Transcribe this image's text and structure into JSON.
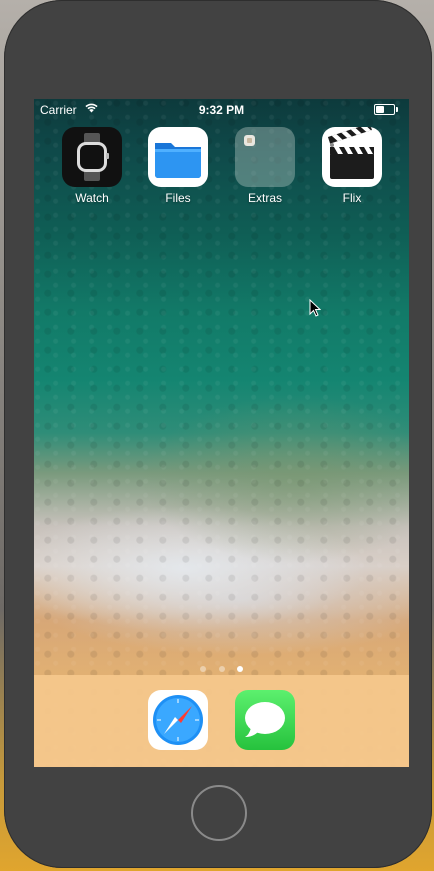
{
  "status_bar": {
    "carrier": "Carrier",
    "time": "9:32 PM"
  },
  "apps": [
    {
      "label": "Watch",
      "icon": "watch-icon"
    },
    {
      "label": "Files",
      "icon": "folder-icon"
    },
    {
      "label": "Extras",
      "icon": "folder-icon"
    },
    {
      "label": "Flix",
      "icon": "clapperboard-icon"
    }
  ],
  "dock": [
    {
      "icon": "safari-icon"
    },
    {
      "icon": "messages-icon"
    }
  ],
  "page_indicator": {
    "pages": 3,
    "current": 3
  },
  "colors": {
    "phone_body": "#424242",
    "dock_bg": "#f5c88c",
    "files_blue": "#1e88f0",
    "messages_green": "#34d04a"
  }
}
